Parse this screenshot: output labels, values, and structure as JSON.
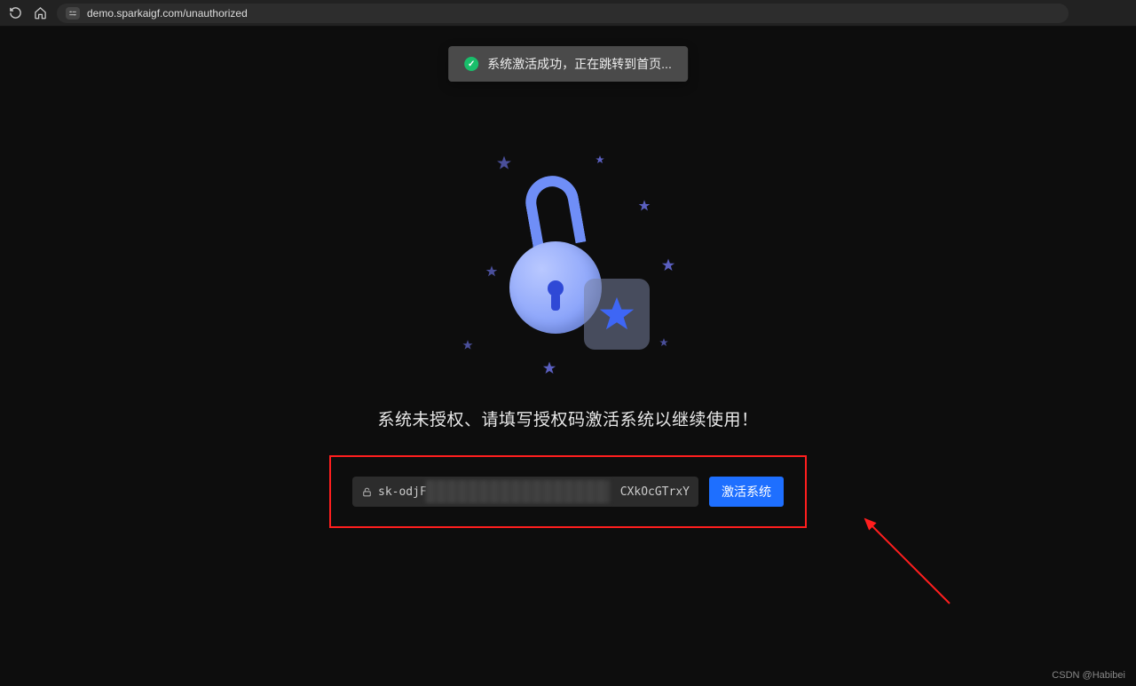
{
  "browser": {
    "url": "demo.sparkaigf.com/unauthorized"
  },
  "toast": {
    "message": "系统激活成功，正在跳转到首页..."
  },
  "page": {
    "title": "系统未授权、请填写授权码激活系统以继续使用！"
  },
  "form": {
    "license_value_prefix": "sk-odjF.",
    "license_value_suffix": "CXkOcGTrxY",
    "activate_label": "激活系统"
  },
  "watermark": "CSDN @Habibei"
}
